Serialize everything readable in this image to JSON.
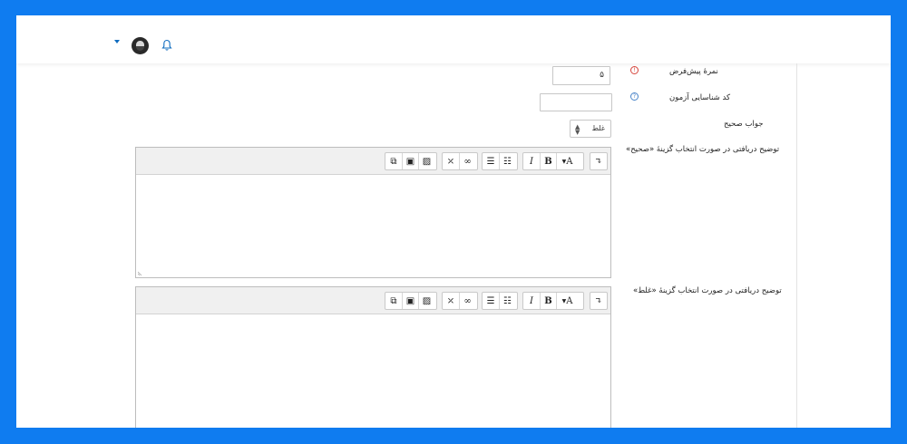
{
  "navbar": {
    "menu_icon": "caret-down-icon",
    "avatar_icon": "user-avatar",
    "notification_icon": "bell-icon"
  },
  "form": {
    "default_mark": {
      "label": "نمرهٔ پیش‌فرض",
      "value": "۵",
      "status_icon": "required-icon"
    },
    "question_id": {
      "label": "کد شناسایی آزمون",
      "value": "",
      "status_icon": "help-icon"
    },
    "correct_answer": {
      "label": "جواب صحیح",
      "selected": "غلط"
    },
    "feedback_true": {
      "label": "توضیح دریافتی در صورت انتخاب گزینهٔ «صحیح»"
    },
    "feedback_false": {
      "label": "توضیح دریافتی در صورت انتخاب گزینهٔ «غلط»"
    }
  },
  "editor_toolbar": {
    "collapse_icon": "collapse-toolbar-icon",
    "font_color_label": "A",
    "bold_label": "B",
    "italic_label": "I",
    "icons": [
      "unordered-list-icon",
      "ordered-list-icon",
      "link-icon",
      "unlink-icon",
      "image-icon",
      "media-icon",
      "manage-files-icon"
    ]
  },
  "colors": {
    "frame_background": "#0f7cf0",
    "accent": "#0f6cbf",
    "required": "#d6433a",
    "help": "#4a85c9"
  }
}
